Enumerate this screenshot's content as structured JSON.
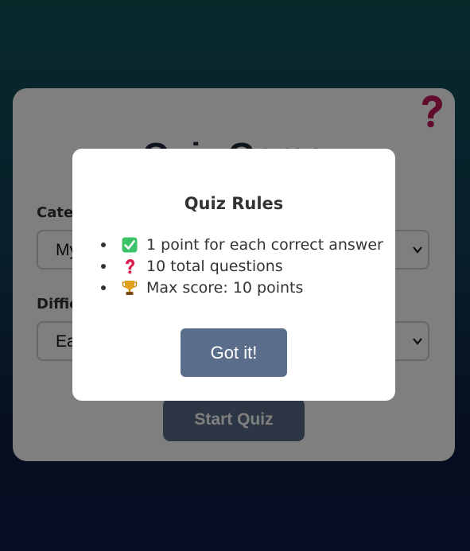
{
  "card": {
    "title": "Quiz Game",
    "category_label": "Category",
    "category_value": "My",
    "difficulty_label": "Difficulty",
    "difficulty_value": "Easy",
    "start_button": "Start Quiz",
    "help_icon": "question-mark-icon"
  },
  "modal": {
    "title": "Quiz Rules",
    "rules": [
      {
        "icon": "check-mark-icon",
        "text": "1 point for each correct answer"
      },
      {
        "icon": "question-mark-icon",
        "text": "10 total questions"
      },
      {
        "icon": "trophy-icon",
        "text": "Max score: 10 points"
      }
    ],
    "button_label": "Got it!"
  },
  "colors": {
    "accent_button": "#5a6d8a",
    "help_icon": "#c2185b",
    "background_top": "#0f5457",
    "background_bottom": "#0e1a44"
  }
}
